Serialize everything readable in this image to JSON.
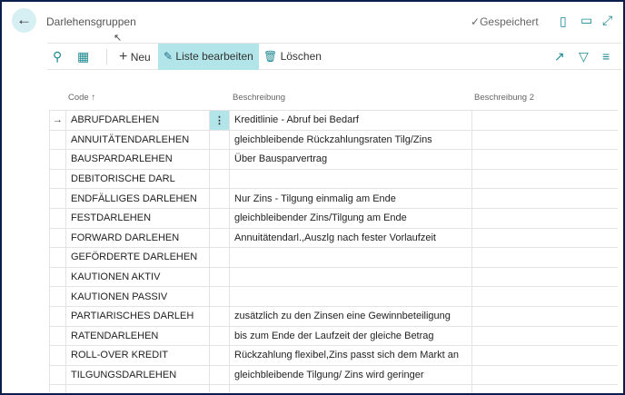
{
  "header": {
    "title": "Darlehensgruppen",
    "status": "Gespeichert"
  },
  "toolbar": {
    "new_label": "Neu",
    "edit_list_label": "Liste bearbeiten",
    "delete_label": "Löschen"
  },
  "columns": {
    "code": "Code",
    "code_sort": "↑",
    "description": "Beschreibung",
    "description2": "Beschreibung 2"
  },
  "accent": "#b1e5e9",
  "rows": [
    {
      "code": "ABRUFDARLEHEN",
      "description": "Kreditlinie - Abruf bei Bedarf",
      "description2": "",
      "selected": true
    },
    {
      "code": "ANNUITÄTENDARLEHEN",
      "description": "gleichbleibende Rückzahlungsraten Tilg/Zins",
      "description2": ""
    },
    {
      "code": "BAUSPARDARLEHEN",
      "description": "Über Bausparvertrag",
      "description2": ""
    },
    {
      "code": "DEBITORISCHE DARL",
      "description": "",
      "description2": ""
    },
    {
      "code": "ENDFÄLLIGES DARLEHEN",
      "description": "Nur Zins - Tilgung einmalig am Ende",
      "description2": ""
    },
    {
      "code": "FESTDARLEHEN",
      "description": "gleichbleibender Zins/Tilgung am Ende",
      "description2": ""
    },
    {
      "code": "FORWARD DARLEHEN",
      "description": "Annuitätendarl.,Auszlg nach fester Vorlaufzeit",
      "description2": ""
    },
    {
      "code": "GEFÖRDERTE DARLEHEN",
      "description": "",
      "description2": ""
    },
    {
      "code": "KAUTIONEN AKTIV",
      "description": "",
      "description2": ""
    },
    {
      "code": "KAUTIONEN PASSIV",
      "description": "",
      "description2": ""
    },
    {
      "code": "PARTIARISCHES DARLEH",
      "description": "zusätzlich zu den Zinsen eine Gewinnbeteiligung",
      "description2": ""
    },
    {
      "code": "RATENDARLEHEN",
      "description": "bis zum Ende der Laufzeit der gleiche Betrag",
      "description2": ""
    },
    {
      "code": "ROLL-OVER KREDIT",
      "description": "Rückzahlung flexibel,Zins passt sich dem Markt an",
      "description2": ""
    },
    {
      "code": "TILGUNGSDARLEHEN",
      "description": "gleichbleibende Tilgung/ Zins wird geringer",
      "description2": ""
    },
    {
      "code": "",
      "description": "",
      "description2": ""
    }
  ]
}
